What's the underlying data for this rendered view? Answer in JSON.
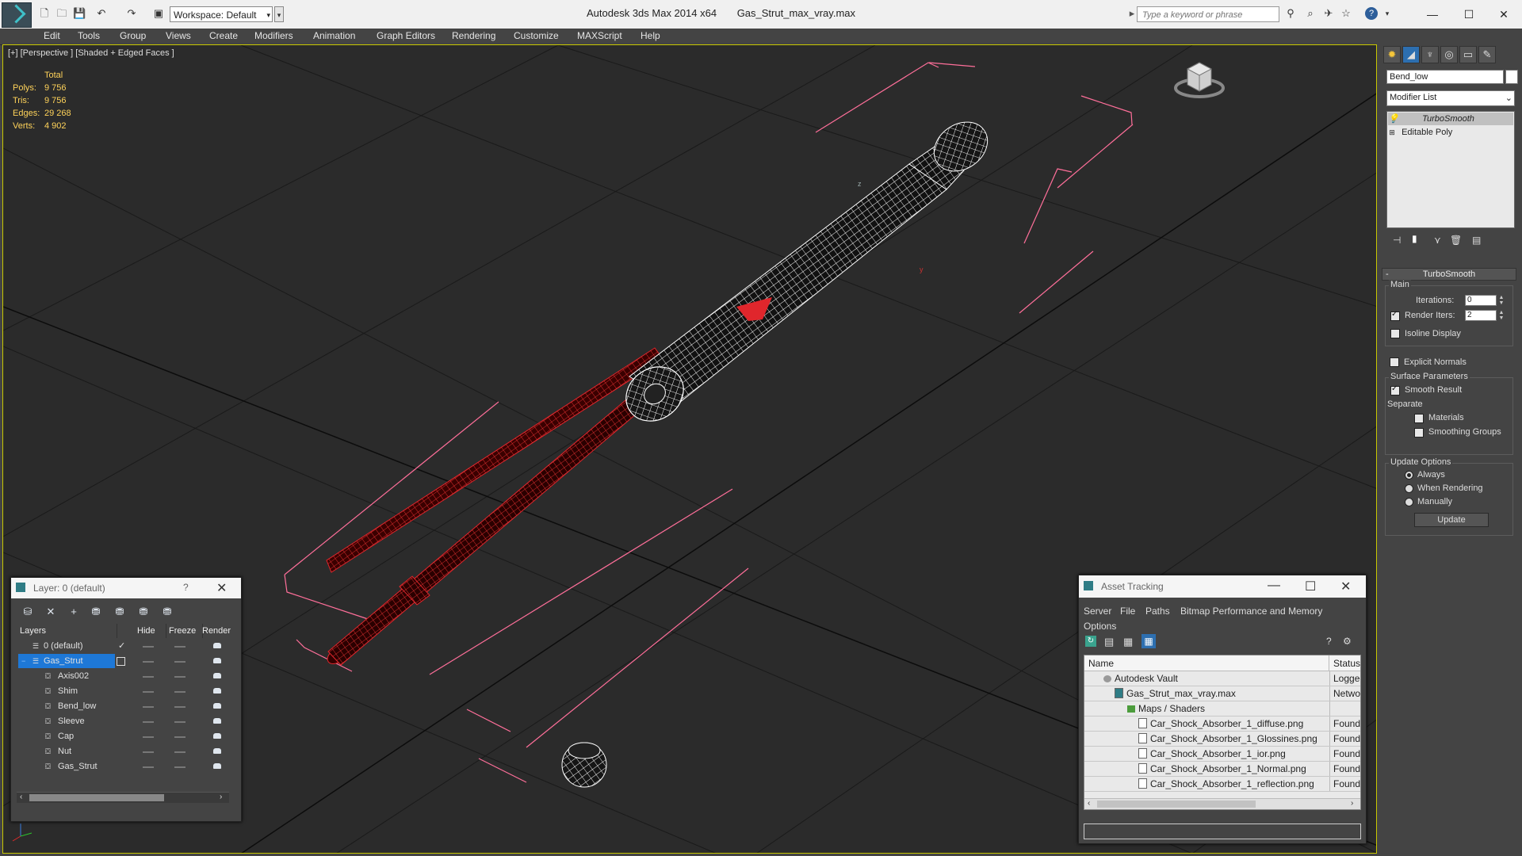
{
  "titlebar": {
    "app_title": "Autodesk 3ds Max  2014 x64",
    "file_title": "Gas_Strut_max_vray.max",
    "workspace": "Workspace: Default",
    "search_placeholder": "Type a keyword or phrase"
  },
  "menu": [
    "Edit",
    "Tools",
    "Group",
    "Views",
    "Create",
    "Modifiers",
    "Animation",
    "Graph Editors",
    "Rendering",
    "Customize",
    "MAXScript",
    "Help"
  ],
  "viewport": {
    "label": "[+] [Perspective ] [Shaded + Edged Faces ]",
    "stats": {
      "header": "Total",
      "rows": [
        {
          "k": "Polys:",
          "v": "9 756"
        },
        {
          "k": "Tris:",
          "v": "9 756"
        },
        {
          "k": "Edges:",
          "v": "29 268"
        },
        {
          "k": "Verts:",
          "v": "4 902"
        }
      ]
    },
    "axis_labels": {
      "z": "z",
      "y": "y"
    }
  },
  "command_panel": {
    "object_name": "Bend_low",
    "modifier_list": "Modifier List",
    "stack": [
      "TurboSmooth",
      "Editable Poly"
    ],
    "rollout_title": "TurboSmooth",
    "main_group": "Main",
    "iterations_label": "Iterations:",
    "iterations_value": "0",
    "render_iters_label": "Render Iters:",
    "render_iters_value": "2",
    "isoline_display": "Isoline Display",
    "explicit_normals": "Explicit Normals",
    "surface_params": "Surface Parameters",
    "smooth_result": "Smooth Result",
    "separate": "Separate",
    "materials": "Materials",
    "smoothing_groups": "Smoothing Groups",
    "update_options": "Update Options",
    "always": "Always",
    "when_rendering": "When Rendering",
    "manually": "Manually",
    "update_button": "Update"
  },
  "layer_dialog": {
    "title": "Layer: 0 (default)",
    "help": "?",
    "columns": [
      "Layers",
      "Hide",
      "Freeze",
      "Render"
    ],
    "rows": [
      {
        "name": "0 (default)",
        "indent": 1
      },
      {
        "name": "Gas_Strut",
        "indent": 1
      },
      {
        "name": "Axis002",
        "indent": 2
      },
      {
        "name": "Shim",
        "indent": 2
      },
      {
        "name": "Bend_low",
        "indent": 2
      },
      {
        "name": "Sleeve",
        "indent": 2
      },
      {
        "name": "Cap",
        "indent": 2
      },
      {
        "name": "Nut",
        "indent": 2
      },
      {
        "name": "Gas_Strut",
        "indent": 2
      }
    ]
  },
  "asset_tracking": {
    "title": "Asset Tracking",
    "menu": [
      "Server",
      "File",
      "Paths",
      "Bitmap Performance and Memory",
      "Options"
    ],
    "columns": [
      "Name",
      "Status"
    ],
    "rows": [
      {
        "name": "Autodesk Vault",
        "status": "Logged",
        "indent": 1,
        "icon": "vault-icon"
      },
      {
        "name": "Gas_Strut_max_vray.max",
        "status": "Networ",
        "indent": 2,
        "icon": "max-file-icon"
      },
      {
        "name": "Maps / Shaders",
        "status": "",
        "indent": 3,
        "icon": "folder-icon"
      },
      {
        "name": "Car_Shock_Absorber_1_diffuse.png",
        "status": "Found",
        "indent": 4,
        "icon": "image-file-icon"
      },
      {
        "name": "Car_Shock_Absorber_1_Glossines.png",
        "status": "Found",
        "indent": 4,
        "icon": "image-file-icon"
      },
      {
        "name": "Car_Shock_Absorber_1_ior.png",
        "status": "Found",
        "indent": 4,
        "icon": "image-file-icon"
      },
      {
        "name": "Car_Shock_Absorber_1_Normal.png",
        "status": "Found",
        "indent": 4,
        "icon": "image-file-icon"
      },
      {
        "name": "Car_Shock_Absorber_1_reflection.png",
        "status": "Found",
        "indent": 4,
        "icon": "image-file-icon"
      }
    ]
  },
  "colors": {
    "accent": "#3fc1c9",
    "selection": "#1e78d7",
    "stats": "#ffd35a",
    "wire_red": "#e0262c"
  }
}
